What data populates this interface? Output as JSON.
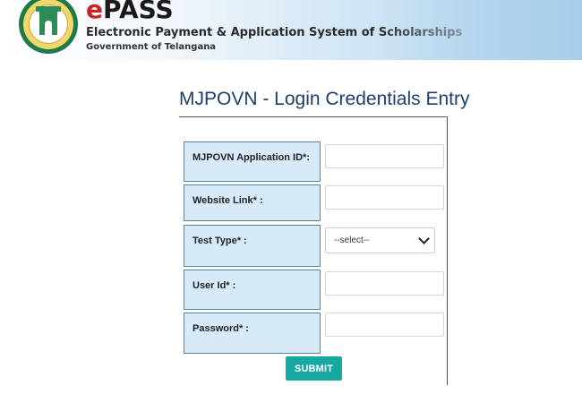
{
  "header": {
    "brand_e": "e",
    "brand_rest": "PASS",
    "subtitle": "Electronic Payment & Application System of Scholarships",
    "government": "Government of Telangana",
    "emblem": "telangana-emblem"
  },
  "form": {
    "title": "MJPOVN - Login Credentials Entry",
    "fields": [
      {
        "label": "MJPOVN Application ID*:",
        "value": "",
        "placeholder": ""
      },
      {
        "label": "Website Link* :",
        "value": "",
        "placeholder": ""
      },
      {
        "label": "Test Type* :",
        "selected": "--select--"
      },
      {
        "label": "User Id* :",
        "value": "",
        "placeholder": ""
      },
      {
        "label": "Password* :",
        "value": "",
        "placeholder": ""
      }
    ],
    "submit_label": "SUBMIT"
  },
  "colors": {
    "label_bg": "#d6eaf8",
    "title": "#1e3e6e",
    "submit_bg": "#17a8a1",
    "brand_red": "#cc2222"
  }
}
